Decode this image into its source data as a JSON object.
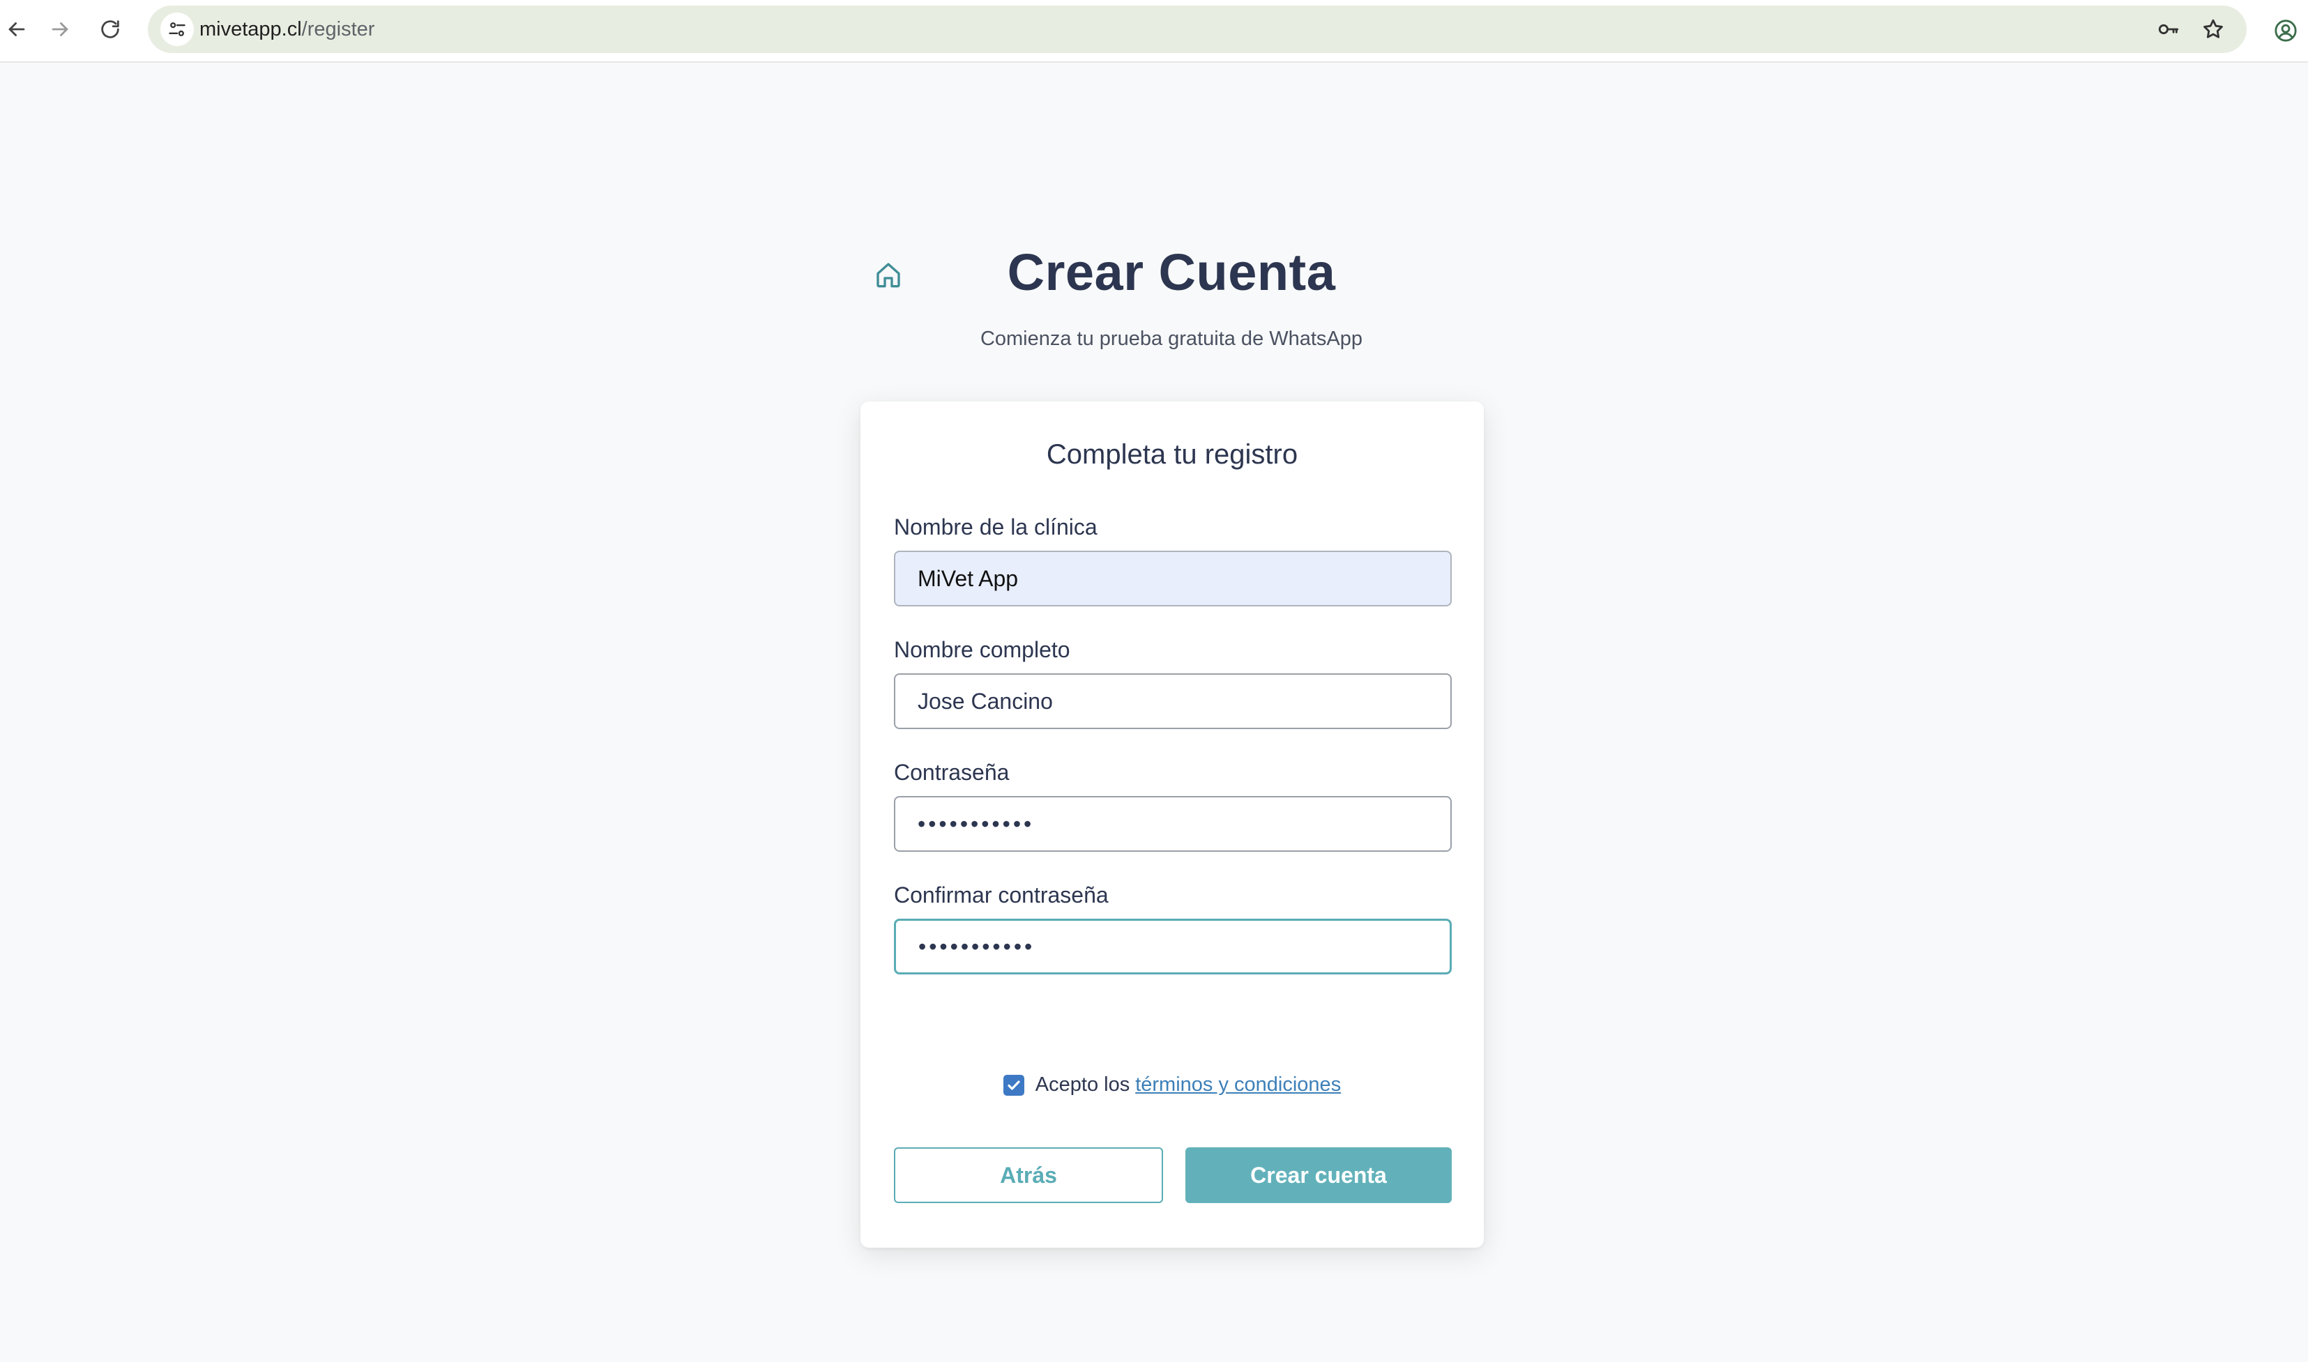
{
  "browser": {
    "url_host": "mivetapp.cl",
    "url_path": "/register"
  },
  "page": {
    "title": "Crear Cuenta",
    "subtitle": "Comienza tu prueba gratuita de WhatsApp"
  },
  "form": {
    "heading": "Completa tu registro",
    "clinic_label": "Nombre de la clínica",
    "clinic_value": "MiVet App",
    "fullname_label": "Nombre completo",
    "fullname_value": "Jose Cancino",
    "password_label": "Contraseña",
    "password_value": "•••••••••••",
    "confirm_label": "Confirmar contraseña",
    "confirm_value": "•••••••••••",
    "terms_prefix": "Acepto los",
    "terms_link": "términos y condiciones",
    "terms_checked": true,
    "back_label": "Atrás",
    "submit_label": "Crear cuenta"
  },
  "colors": {
    "accent": "#5aacb5",
    "title": "#2d3650",
    "checkbox": "#3d79c4",
    "link": "#3d7fb8"
  }
}
